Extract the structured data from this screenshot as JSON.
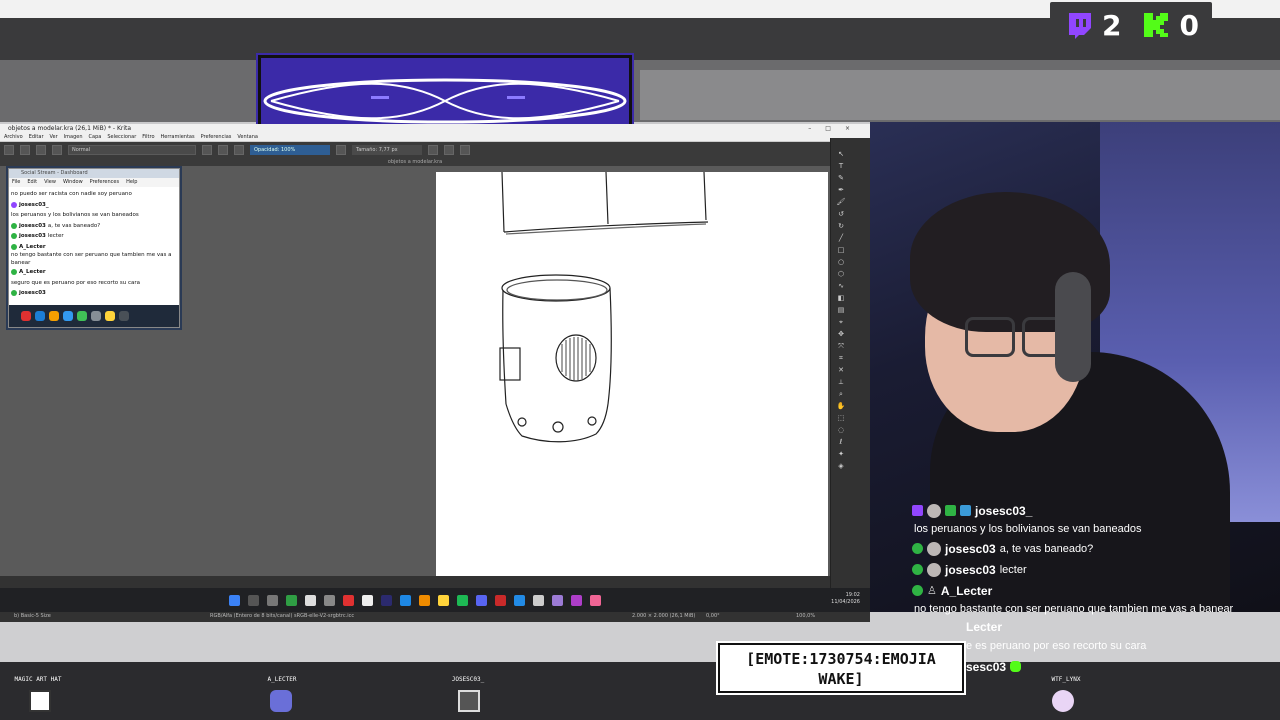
{
  "counters": [
    {
      "icon": "twitch-icon",
      "value": "2",
      "color": "#9146ff"
    },
    {
      "icon": "kick-icon",
      "value": "0",
      "color": "#53fc18"
    }
  ],
  "krita": {
    "window_title": "objetos a modelar.kra (26,1 MiB) * - Krita",
    "menu": [
      "Archivo",
      "Editar",
      "Ver",
      "Imagen",
      "Capa",
      "Seleccionar",
      "Filtro",
      "Herramientas",
      "Preferencias",
      "Ventana"
    ],
    "blend_mode": "Normal",
    "opacity": "Opacidad: 100%",
    "size": "Tamaño: 7,77 px",
    "doc_tab": "objetos a modelar.kra",
    "status_brush": "b) Basic-5 Size",
    "status_color": "RGB/Alfa (Entero de 8 bits/canal)  sRGB-elle-V2-srgbtrc.icc",
    "status_dims": "2.000 × 2.000 (26,1 MiB)",
    "status_angle": "0,00°",
    "status_zoom": "100,0%",
    "clock_time": "19:02",
    "clock_date": "11/04/2026"
  },
  "social_stream": {
    "title": "Social Stream - Dashboard",
    "menu": [
      "File",
      "Edit",
      "View",
      "Window",
      "Preferences",
      "Help"
    ],
    "lines": [
      {
        "user": "",
        "text": "no puedo ser racista con nadie soy peruano"
      },
      {
        "user": "josesc03_",
        "text": ""
      },
      {
        "user": "",
        "text": "los peruanos y los bolivianos se van baneados"
      },
      {
        "user": "josesc03",
        "text": "a, te vas baneado?"
      },
      {
        "user": "josesc03",
        "text": "lecter"
      },
      {
        "user": "A_Lecter",
        "text": ""
      },
      {
        "user": "",
        "text": "no tengo bastante con ser peruano que tambien me vas a"
      },
      {
        "user": "",
        "text": "banear"
      },
      {
        "user": "A_Lecter",
        "text": ""
      },
      {
        "user": "",
        "text": "seguro que es peruano por eso recorto su cara"
      },
      {
        "user": "josesc03",
        "text": ""
      }
    ]
  },
  "chat_overlay": {
    "messages": [
      {
        "user": "josesc03_",
        "text": "",
        "platform": "twitch"
      },
      {
        "user": "",
        "text": "los peruanos y los bolivianos se van baneados"
      },
      {
        "user": "josesc03",
        "text": "a, te vas baneado?",
        "platform": "kick"
      },
      {
        "user": "josesc03",
        "text": "lecter",
        "platform": "kick"
      },
      {
        "user": "A_Lecter",
        "text": "",
        "platform": "kick"
      },
      {
        "user": "",
        "text": "no tengo bastante con ser peruano que tambien me vas a banear"
      },
      {
        "user": "Lecter",
        "text": ""
      },
      {
        "user": "",
        "text": "e es peruano por eso recorto su cara"
      },
      {
        "user": "sesc03",
        "text": ""
      }
    ]
  },
  "emote": {
    "text": "[EMOTE:1730754:EMOJIA WAKE]"
  },
  "bottom_users": [
    "MAGIC ART HAT",
    "A_LECTER",
    "JOSESC03_",
    "WTF_LYNX"
  ]
}
